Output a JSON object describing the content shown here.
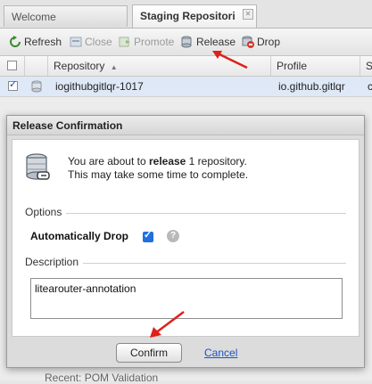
{
  "tabs": [
    {
      "label": "Welcome",
      "active": false
    },
    {
      "label": "Staging Repositori",
      "active": true,
      "close_glyph": "✕"
    }
  ],
  "toolbar": {
    "refresh_label": "Refresh",
    "close_label": "Close",
    "promote_label": "Promote",
    "release_label": "Release",
    "drop_label": "Drop"
  },
  "grid": {
    "columns": [
      "Repository",
      "Profile",
      "S"
    ],
    "sort_indicator": "▲",
    "rows": [
      {
        "checked": true,
        "repository": "iogithubgitlqr-1017",
        "profile": "io.github.gitlqr",
        "status": "c"
      }
    ],
    "partial_text": "Recent: POM Validation"
  },
  "dialog": {
    "title": "Release Confirmation",
    "message_pre": "You are about to ",
    "message_bold": "release",
    "message_post": " 1 repository.",
    "message_line2": "This may take some time to complete.",
    "options_label": "Options",
    "auto_drop_label": "Automatically Drop",
    "auto_drop_checked": true,
    "help_glyph": "?",
    "description_label": "Description",
    "description_value": "litearouter-annotation",
    "confirm_label": "Confirm",
    "cancel_label": "Cancel"
  },
  "colors": {
    "arrow": "#e0201b",
    "link": "#1a52c4",
    "checkbox_accent": "#1f6fe0",
    "selected_row": "#dfe8f6"
  }
}
